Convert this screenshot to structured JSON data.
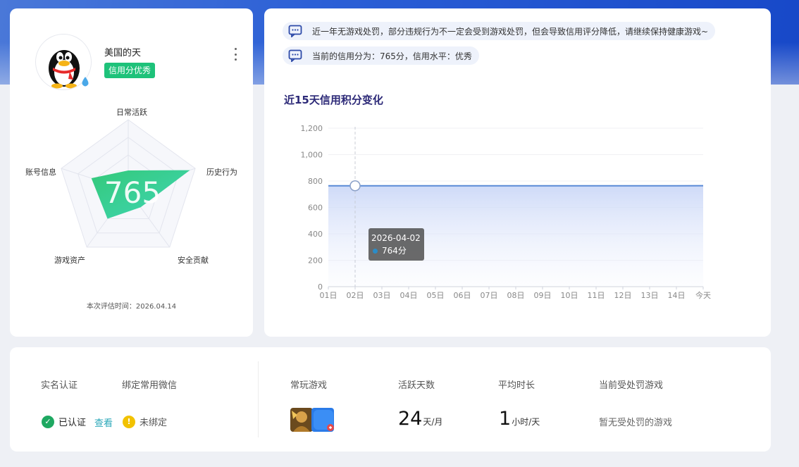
{
  "profile": {
    "username": "美国的天",
    "credit_badge": "信用分优秀",
    "score": "765",
    "eval_time": "本次评估时间：2026.04.14",
    "radar": {
      "axes": [
        "日常活跃",
        "历史行为",
        "安全贡献",
        "游戏资产",
        "账号信息"
      ],
      "values": [
        0.28,
        0.92,
        0.3,
        0.5,
        0.55
      ]
    }
  },
  "notices": [
    "近一年无游戏处罚，部分违规行为不一定会受到游戏处罚，但会导致信用评分降低，请继续保持健康游戏~",
    "当前的信用分为：765分，信用水平：优秀"
  ],
  "chart": {
    "title": "近15天信用积分变化",
    "tooltip": {
      "date": "2026-04-02",
      "value": "764分"
    }
  },
  "chart_data": {
    "type": "area",
    "title": "近15天信用积分变化",
    "categories": [
      "01日",
      "02日",
      "03日",
      "04日",
      "05日",
      "06日",
      "07日",
      "08日",
      "09日",
      "10日",
      "11日",
      "12日",
      "13日",
      "14日",
      "今天"
    ],
    "values": [
      764,
      764,
      764,
      764,
      764,
      764,
      764,
      764,
      764,
      764,
      764,
      764,
      764,
      764,
      765
    ],
    "ylim": [
      0,
      1200
    ],
    "yticks": [
      0,
      200,
      400,
      600,
      800,
      "1,000",
      "1,200"
    ],
    "grid": true
  },
  "bottom": {
    "realname_label": "实名认证",
    "wechat_label": "绑定常用微信",
    "realname_status": "已认证",
    "view_link": "查看",
    "wechat_status": "未绑定",
    "games_label": "常玩游戏",
    "active_days_label": "活跃天数",
    "active_days_value": "24",
    "active_days_unit": "天/月",
    "avg_time_label": "平均时长",
    "avg_time_value": "1",
    "avg_time_unit": "小时/天",
    "penalty_label": "当前受处罚游戏",
    "penalty_value": "暂无受处罚的游戏"
  },
  "colors": {
    "accent_green": "#1ec27a",
    "line_blue": "#5a8ad6",
    "title_purple": "#2d2a78",
    "link_teal": "#29a7b8"
  },
  "icons": {
    "avatar": "qq-penguin-icon",
    "notice": "message-icon",
    "verified": "check-circle-icon",
    "unbound": "warning-circle-icon",
    "more": "more-vertical-icon"
  }
}
